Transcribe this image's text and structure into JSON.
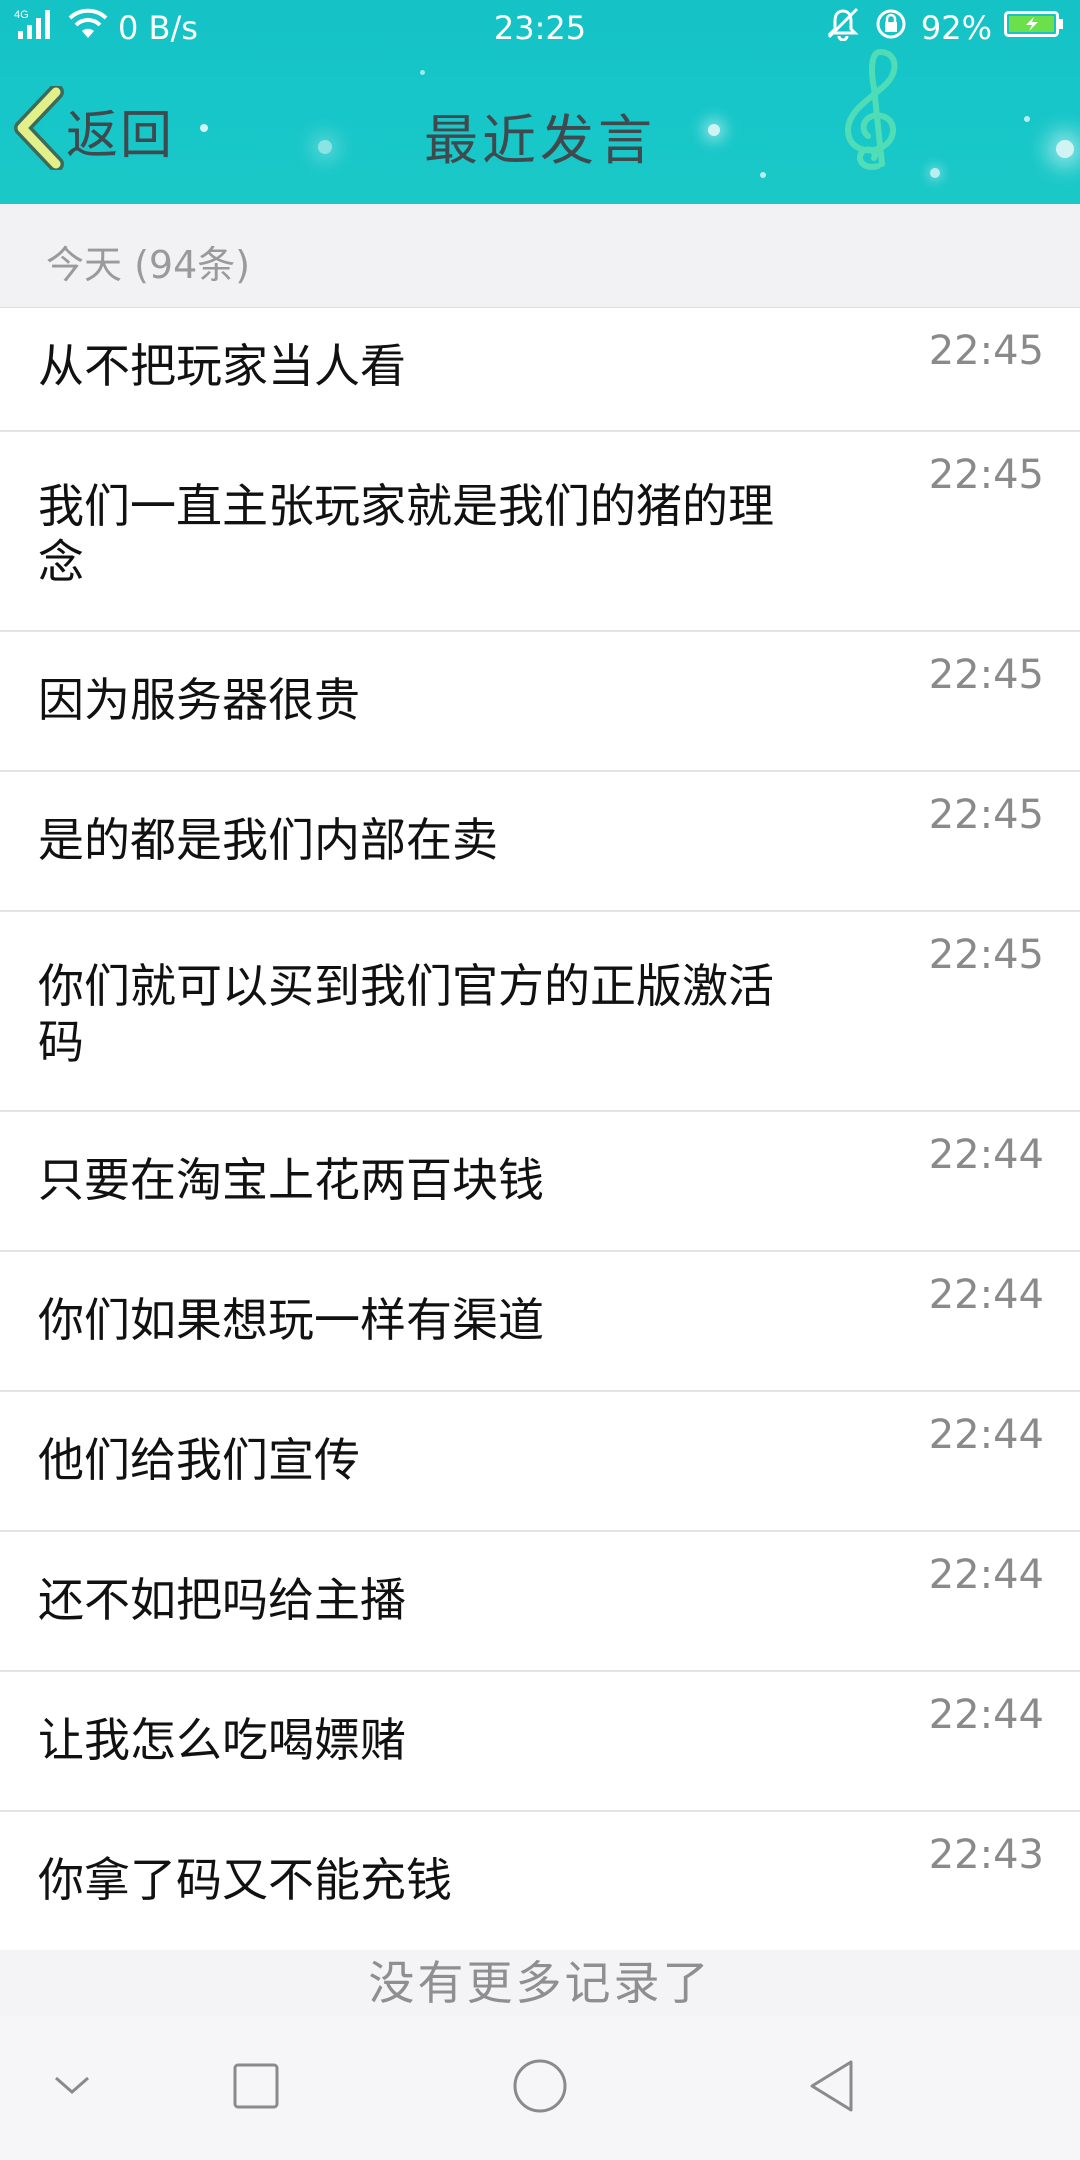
{
  "status_bar": {
    "network": "4G",
    "speed": "0 B/s",
    "time": "23:25",
    "battery": "92%"
  },
  "header": {
    "back_label": "返回",
    "title": "最近发言"
  },
  "section": {
    "label": "今天 (94条)"
  },
  "messages": [
    {
      "text": "从不把玩家当人看",
      "time": "22:45"
    },
    {
      "text": "我们一直主张玩家就是我们的猪的理念",
      "time": "22:45"
    },
    {
      "text": "因为服务器很贵",
      "time": "22:45"
    },
    {
      "text": "是的都是我们内部在卖",
      "time": "22:45"
    },
    {
      "text": "你们就可以买到我们官方的正版激活码",
      "time": "22:45"
    },
    {
      "text": "只要在淘宝上花两百块钱",
      "time": "22:44"
    },
    {
      "text": "你们如果想玩一样有渠道",
      "time": "22:44"
    },
    {
      "text": "他们给我们宣传",
      "time": "22:44"
    },
    {
      "text": "还不如把吗给主播",
      "time": "22:44"
    },
    {
      "text": "让我怎么吃喝嫖赌",
      "time": "22:44"
    },
    {
      "text": "你拿了码又不能充钱",
      "time": "22:43"
    }
  ],
  "footer": {
    "no_more": "没有更多记录了"
  },
  "colors": {
    "header_bg": "#16c6c9",
    "title_text": "#3f4a4e",
    "back_chevron": "#e3f08a",
    "battery_fill": "#6be04a"
  }
}
